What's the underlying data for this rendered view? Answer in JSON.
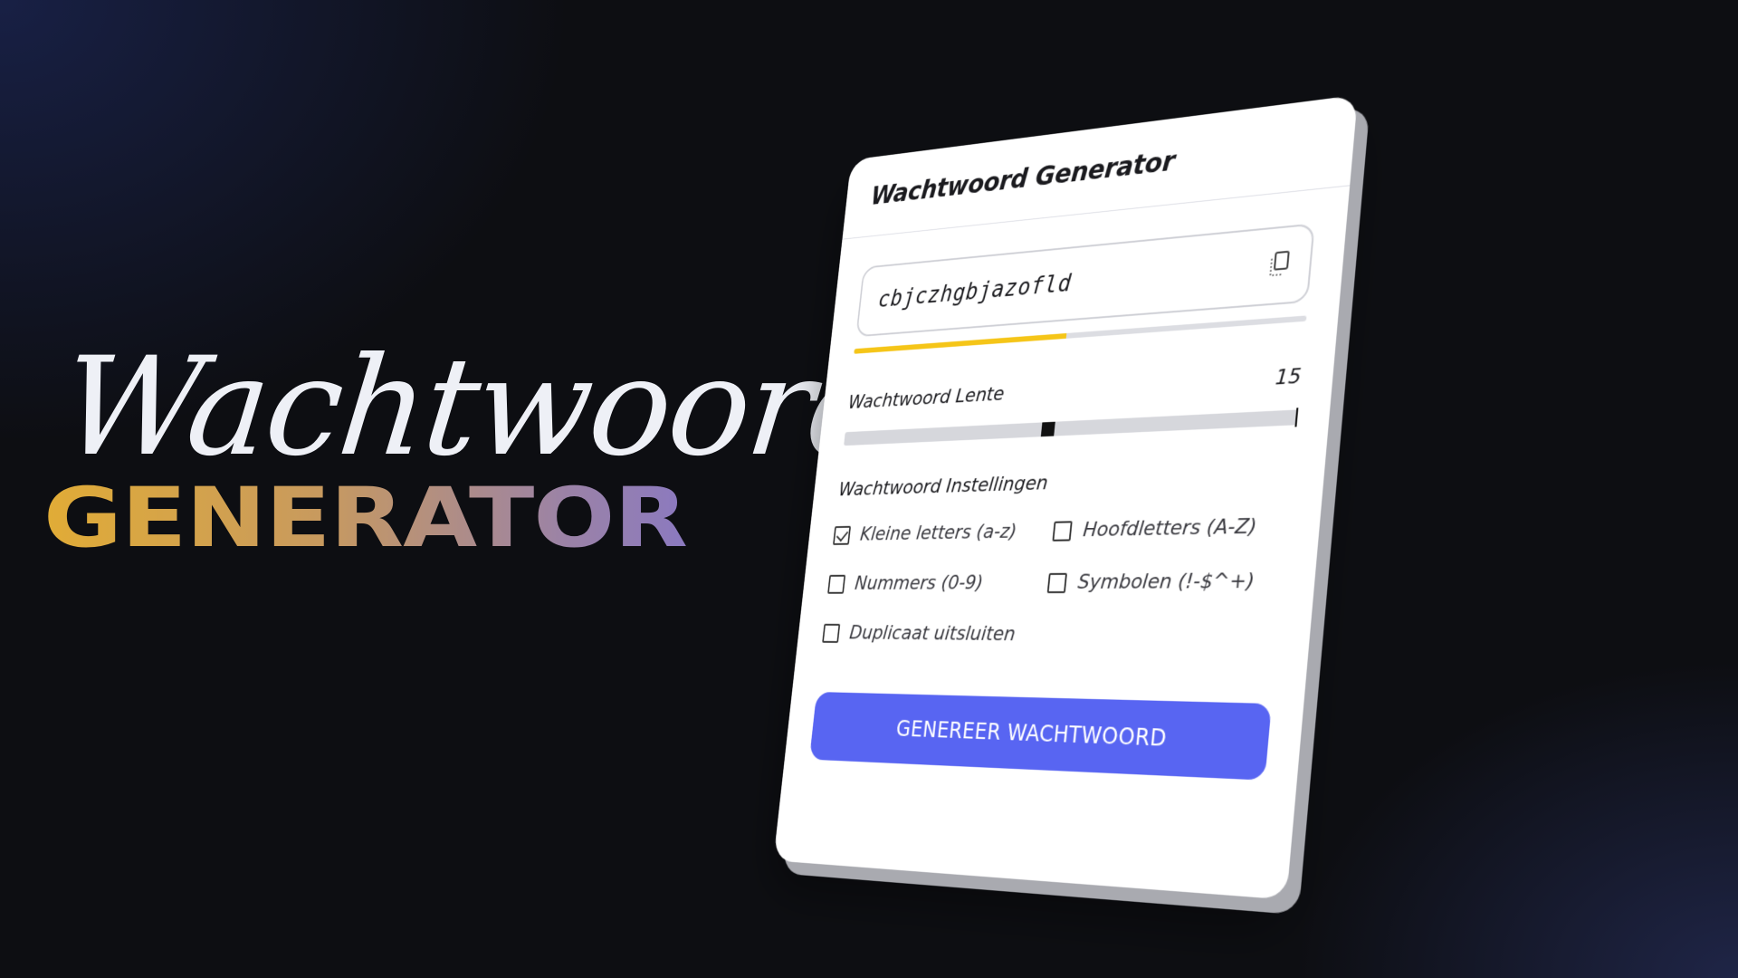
{
  "hero": {
    "script_title": "Wachtwoord",
    "bold_title": "GENERATOR"
  },
  "card": {
    "title": "Wachtwoord Generator",
    "password_value": "cbjczhgbjazofld",
    "strength_fraction": 0.5,
    "strength_color": "#f5c518",
    "length_label": "Wachtwoord Lente",
    "length_value": "15",
    "length_slider_fraction": 0.48,
    "settings_title": "Wachtwoord Instellingen",
    "options": [
      {
        "label": "Kleine letters (a-z)",
        "checked": true
      },
      {
        "label": "Hoofdletters (A-Z)",
        "checked": false
      },
      {
        "label": "Nummers (0-9)",
        "checked": false
      },
      {
        "label": "Symbolen (!-$^+)",
        "checked": false
      },
      {
        "label": "Duplicaat uitsluiten",
        "checked": false
      }
    ],
    "generate_button_label": "GENEREER WACHTWOORD",
    "accent_color": "#5865f2"
  }
}
